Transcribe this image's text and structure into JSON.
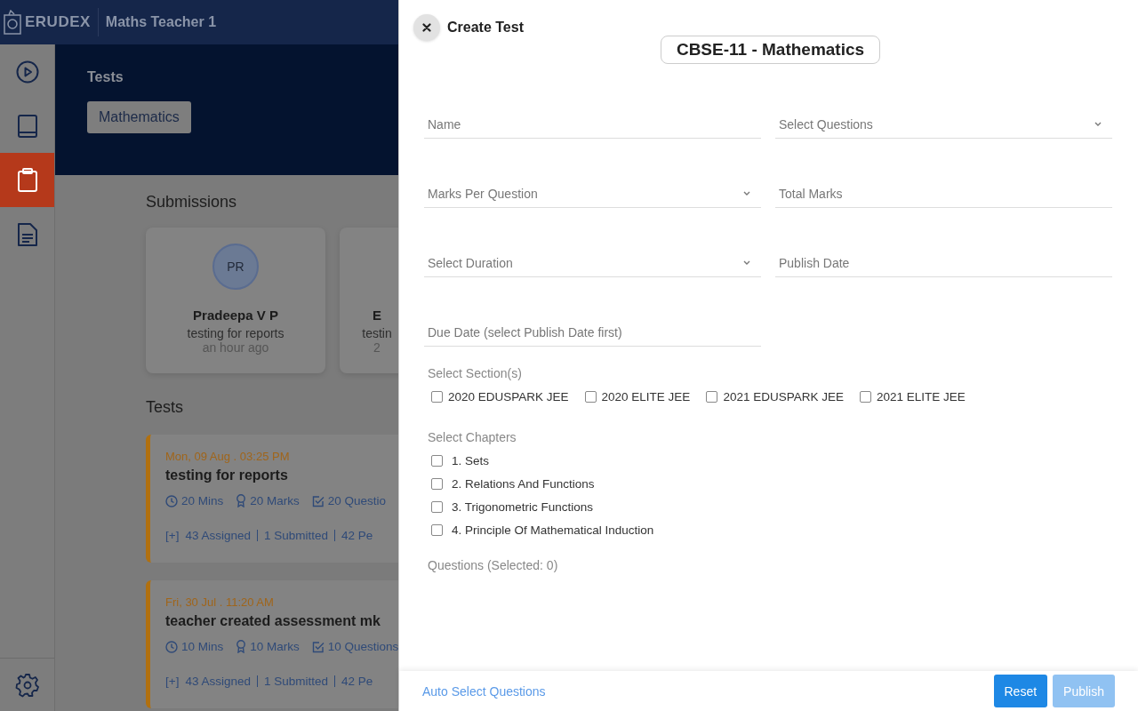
{
  "header": {
    "logo": "ERUDEX",
    "user": "Maths Teacher 1"
  },
  "sidebar": {
    "items": [
      {
        "kind": "play",
        "selected": false
      },
      {
        "kind": "book",
        "selected": false
      },
      {
        "kind": "clipboard",
        "selected": true
      },
      {
        "kind": "document",
        "selected": false
      }
    ],
    "bottom": {
      "kind": "settings",
      "selected": false
    }
  },
  "banner": {
    "title": "Tests",
    "chip": "Mathematics"
  },
  "submissions": {
    "title": "Submissions",
    "cards": [
      {
        "initials": "PR",
        "name": "Pradeepa V P",
        "test": "testing for reports",
        "time": "an hour ago"
      },
      {
        "name": "E",
        "test": "testin",
        "time": "2"
      }
    ]
  },
  "tests": {
    "title": "Tests",
    "items": [
      {
        "date": "Mon, 09 Aug . 03:25 PM",
        "title": "testing for reports",
        "duration": "20 Mins",
        "marks": "20 Marks",
        "questions": "20 Questio",
        "expand": "[+]",
        "assigned": "43 Assigned",
        "submitted": "1 Submitted",
        "pending": "42 Pe"
      },
      {
        "date": "Fri, 30 Jul . 11:20 AM",
        "title": "teacher created assessment mk",
        "duration": "10 Mins",
        "marks": "10 Marks",
        "questions": "10 Questions",
        "expand": "[+]",
        "assigned": "43 Assigned",
        "submitted": "1 Submitted",
        "pending": "42 Pe"
      }
    ]
  },
  "drawer": {
    "title": "Create Test",
    "subject": "CBSE-11 - Mathematics",
    "fields": [
      {
        "kind": "text",
        "placeholder": "Name"
      },
      {
        "kind": "select",
        "placeholder": "Select Questions"
      },
      {
        "kind": "select",
        "placeholder": "Marks Per Question"
      },
      {
        "kind": "text",
        "placeholder": "Total Marks"
      },
      {
        "kind": "select",
        "placeholder": "Select Duration"
      },
      {
        "kind": "text",
        "placeholder": "Publish Date"
      },
      {
        "kind": "text",
        "placeholder": "Due Date (select Publish Date first)"
      }
    ],
    "sections": {
      "label": "Select Section(s)",
      "options": [
        {
          "label": "2020 EDUSPARK JEE",
          "checked": false
        },
        {
          "label": "2020 ELITE JEE",
          "checked": false
        },
        {
          "label": "2021 EDUSPARK JEE",
          "checked": false
        },
        {
          "label": "2021 ELITE JEE",
          "checked": false
        }
      ]
    },
    "chapters": {
      "label": "Select Chapters",
      "options": [
        {
          "label": "1. Sets",
          "checked": false
        },
        {
          "label": "2. Relations And Functions",
          "checked": false
        },
        {
          "label": "3. Trigonometric Functions",
          "checked": false
        },
        {
          "label": "4. Principle Of Mathematical Induction",
          "checked": false
        }
      ]
    },
    "questions_label": "Questions (Selected: 0)",
    "footer": {
      "link": "Auto Select Questions",
      "buttons": [
        {
          "label": "Reset",
          "disabled": false
        },
        {
          "label": "Publish",
          "disabled": true
        }
      ]
    }
  }
}
